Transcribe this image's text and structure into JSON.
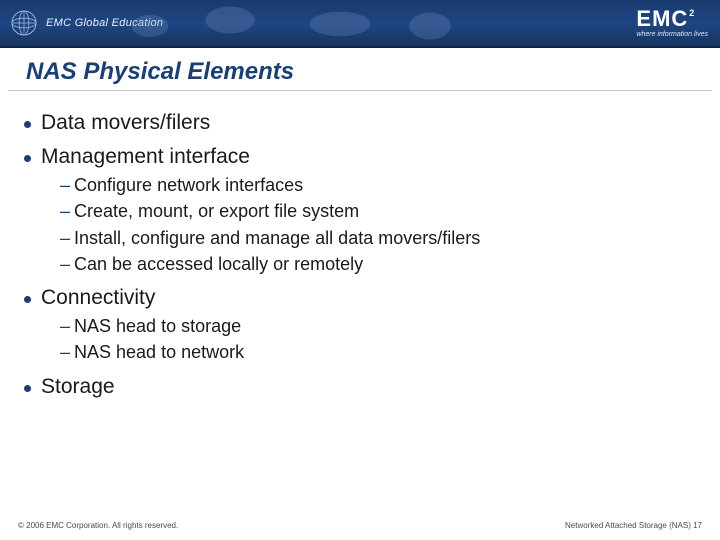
{
  "header": {
    "brand_left": "EMC Global Education",
    "brand_right": "EMC",
    "brand_sup": "2",
    "tagline": "where information lives"
  },
  "slide": {
    "title": "NAS Physical Elements"
  },
  "bullets": {
    "b1": "Data movers/filers",
    "b2": "Management interface",
    "b2_subs": {
      "s1": "Configure network interfaces",
      "s2": "Create, mount, or export file system",
      "s3": "Install, configure and manage all data movers/filers",
      "s4": "Can be accessed locally or remotely"
    },
    "b3": "Connectivity",
    "b3_subs": {
      "s1": "NAS head to storage",
      "s2": "NAS head to network"
    },
    "b4": "Storage"
  },
  "footer": {
    "copyright": "© 2006 EMC Corporation. All rights reserved.",
    "page_label": "Networked Attached Storage (NAS) 17"
  }
}
